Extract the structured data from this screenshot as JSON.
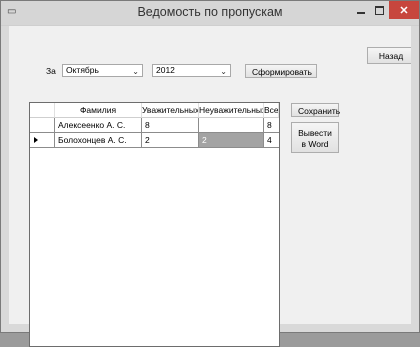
{
  "window": {
    "title": "Ведомость по пропускам",
    "icon": "form-icon",
    "close_glyph": "✕"
  },
  "toolbar": {
    "back_label": "Назад",
    "period_label": "За",
    "month_value": "Октябрь",
    "year_value": "2012",
    "generate_label": "Сформировать"
  },
  "actions": {
    "save_label": "Сохранить",
    "export_label": "Вывести в Word"
  },
  "grid": {
    "columns": [
      "Фамилия",
      "Уважительных",
      "Неуважительных",
      "Всего"
    ],
    "rows": [
      {
        "name": "Алексеенко А. С.",
        "excused": "8",
        "unexcused": "",
        "total": "8"
      },
      {
        "name": "Болохонцев А. С.",
        "excused": "2",
        "unexcused": "2",
        "total": "4"
      }
    ],
    "selection_color": "#a3a3a3"
  }
}
